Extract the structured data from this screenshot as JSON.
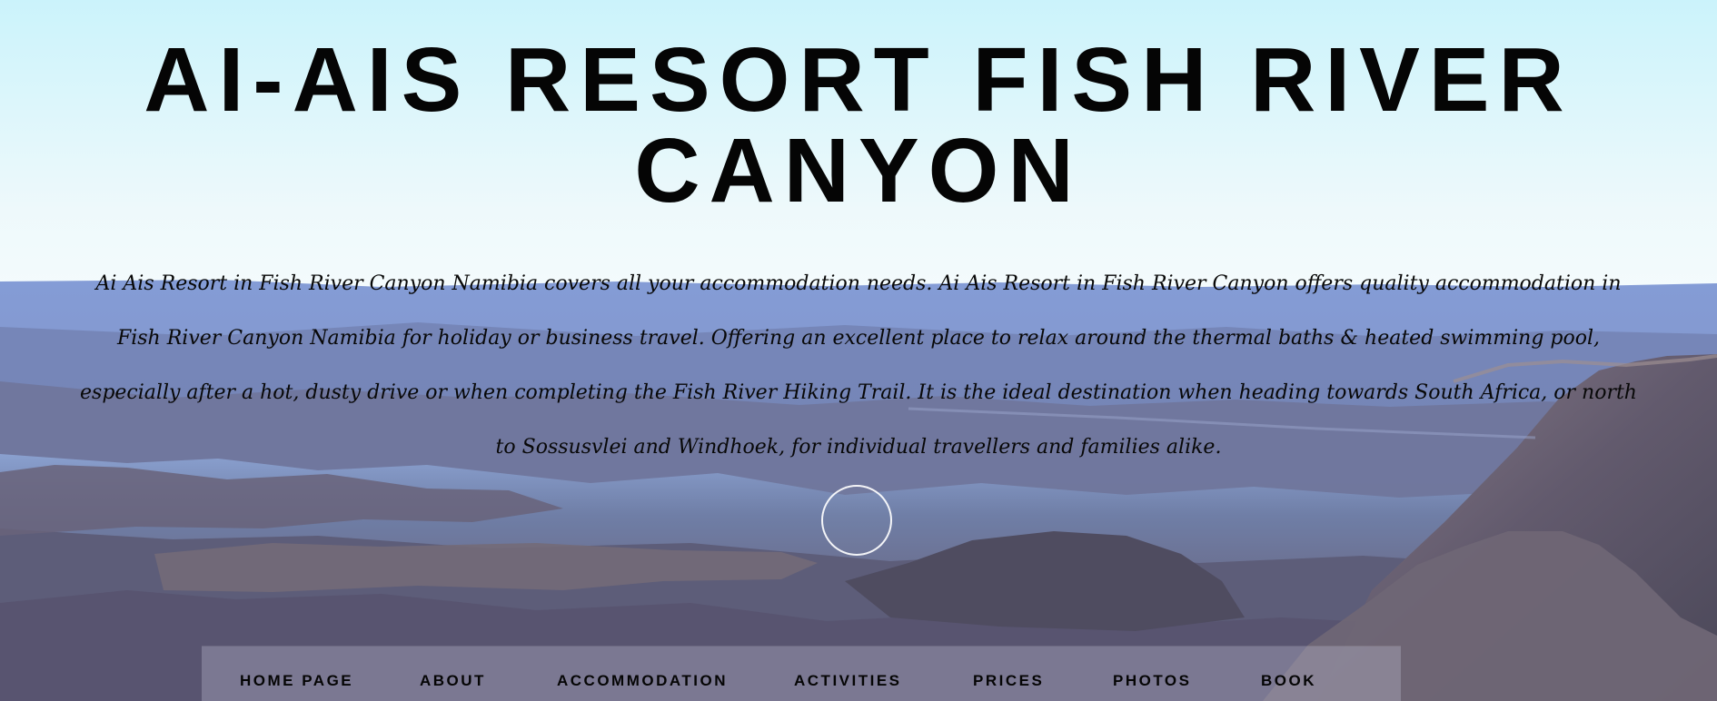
{
  "hero": {
    "title_line1": "AI-AIS RESORT FISH RIVER",
    "title_line2": "CANYON",
    "intro_text": "Ai Ais Resort in Fish River Canyon Namibia covers all your accommodation needs. Ai Ais Resort in Fish River Canyon offers quality accommodation in Fish River Canyon Namibia for holiday or business travel. Offering an excellent place to relax around the thermal baths & heated swimming pool, especially after a hot, dusty drive or when completing the Fish River Hiking Trail. It is the ideal destination when heading towards South Africa, or north to Sossusvlei and Windhoek, for individual travellers and families alike."
  },
  "nav": {
    "items": [
      {
        "label": "HOME PAGE"
      },
      {
        "label": "ABOUT"
      },
      {
        "label": "ACCOMMODATION"
      },
      {
        "label": "ACTIVITIES"
      },
      {
        "label": "PRICES"
      },
      {
        "label": "PHOTOS"
      },
      {
        "label": "BOOK"
      }
    ]
  },
  "colors": {
    "sky_top": "#d5f4fb",
    "canyon_blue": "#7e8fb8",
    "canyon_purple": "#67607f",
    "text_dark": "#050505",
    "nav_overlay": "#b8b8cf"
  },
  "icons": {
    "scroll_indicator": "circle-outline-icon"
  }
}
